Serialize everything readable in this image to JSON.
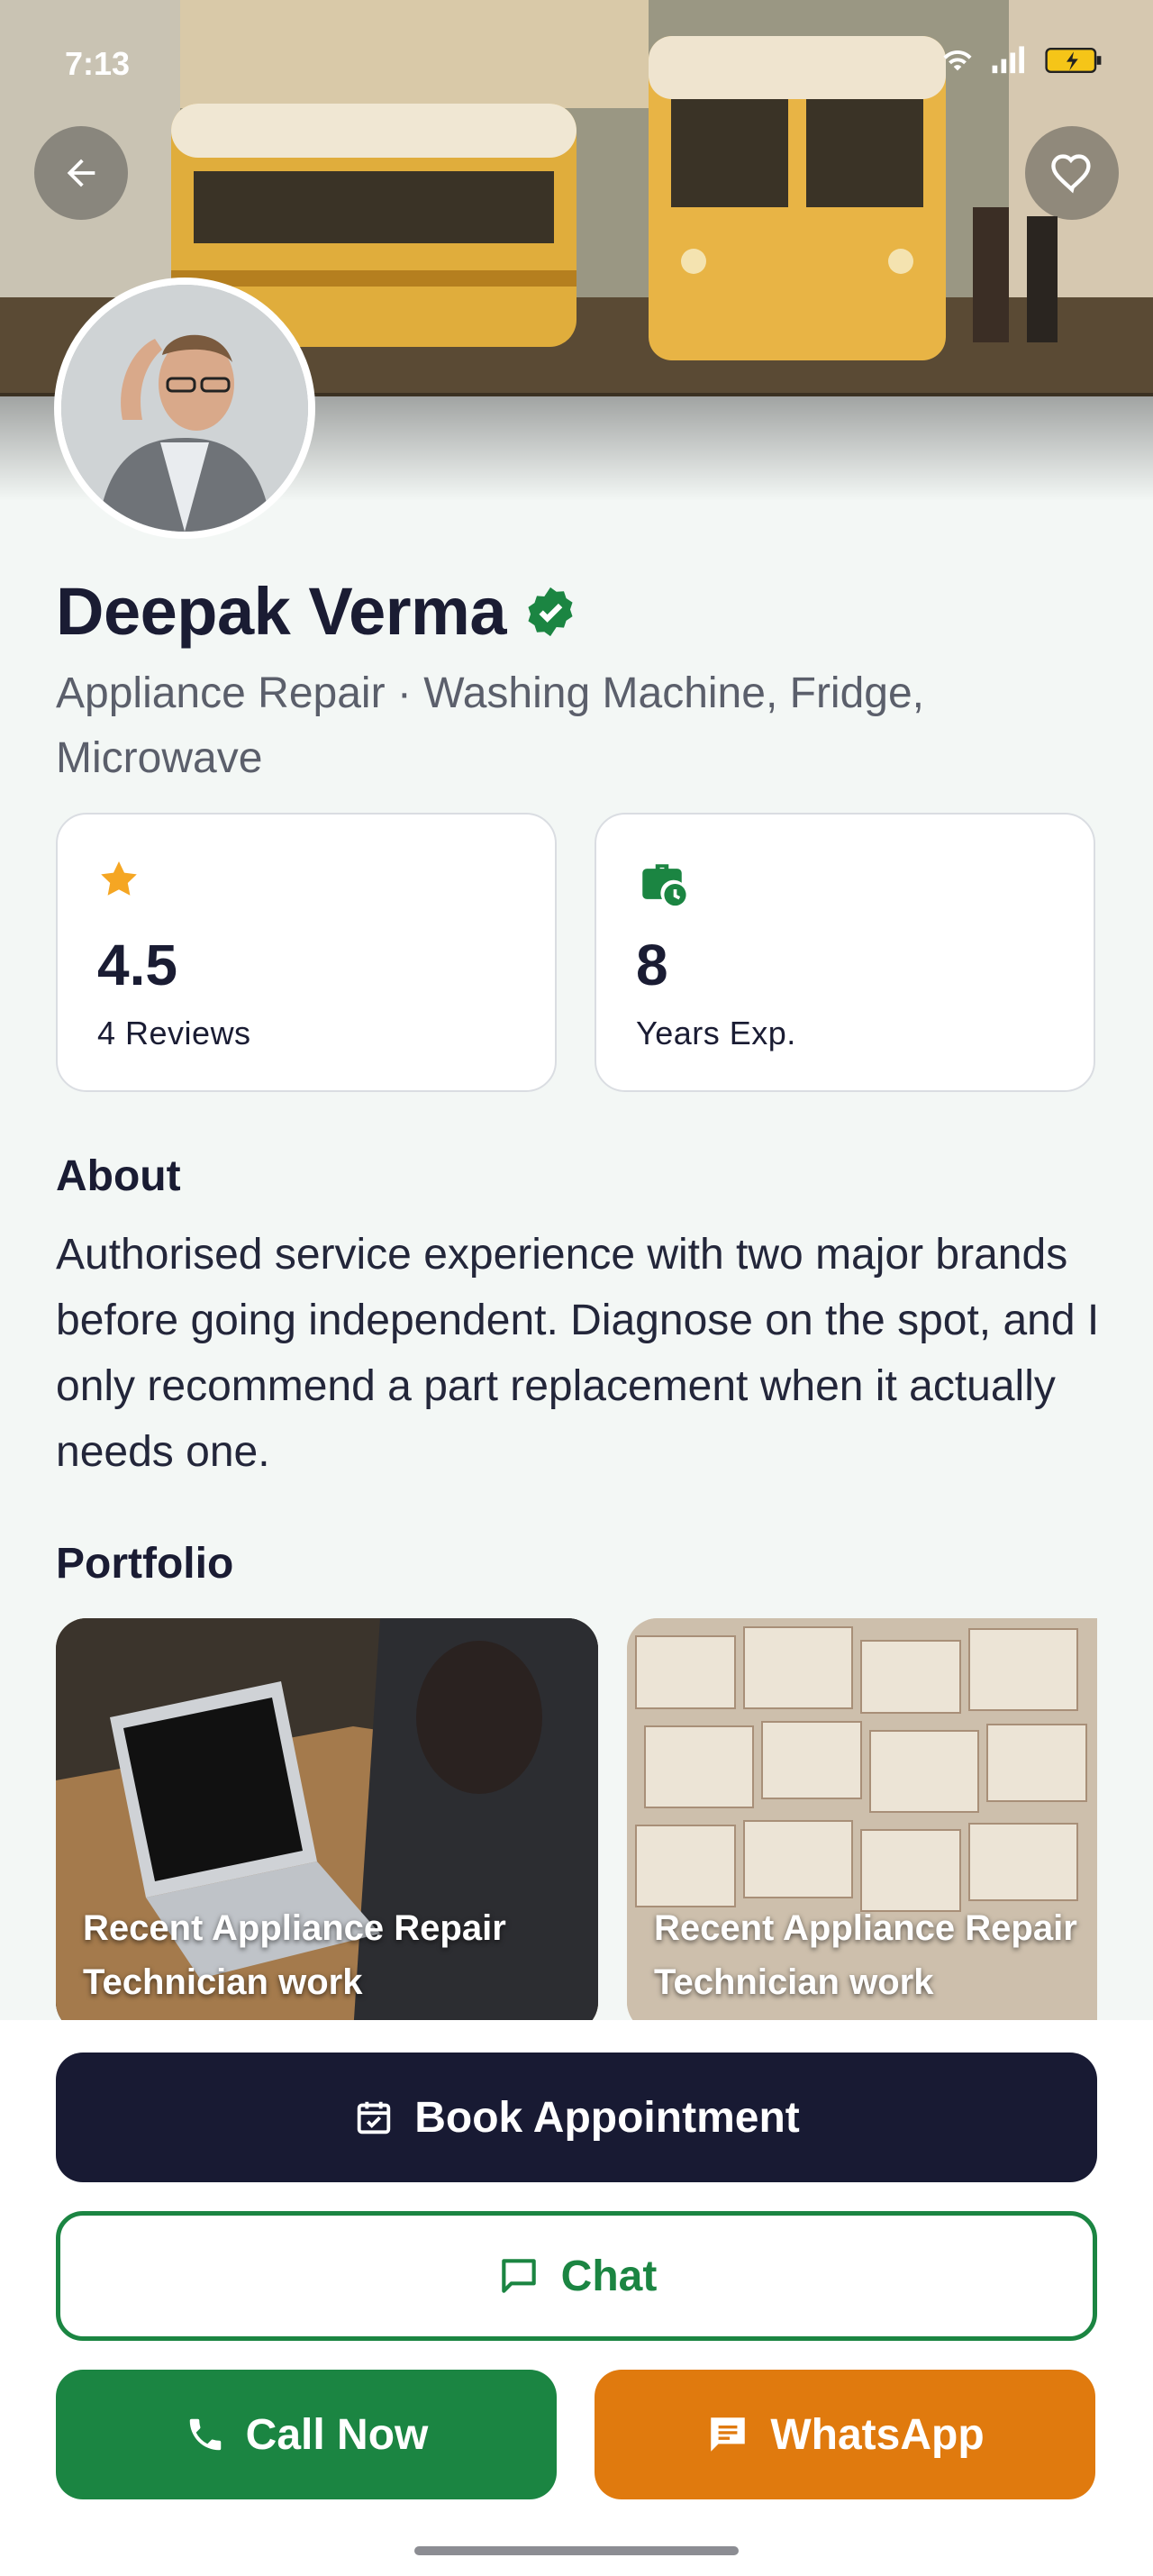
{
  "status_bar": {
    "time": "7:13"
  },
  "header": {
    "back_label": "back",
    "favorite_label": "favorite"
  },
  "profile": {
    "name": "Deepak Verma",
    "verified": true,
    "subtitle": "Appliance Repair · Washing Machine, Fridge, Microwave"
  },
  "stats": {
    "rating": {
      "value": "4.5",
      "label": "4 Reviews",
      "icon": "star-icon",
      "color": "#f5a623"
    },
    "experience": {
      "value": "8",
      "label": "Years Exp.",
      "icon": "briefcase-clock-icon",
      "color": "#1b8542"
    }
  },
  "about": {
    "title": "About",
    "body": "Authorised service experience with two major brands before going independent. Diagnose on the spot, and I only recommend a part replacement when it actually needs one."
  },
  "portfolio": {
    "title": "Portfolio",
    "items": [
      {
        "caption": "Recent Appliance Repair Technician work"
      },
      {
        "caption": "Recent Appliance Repair Technician work"
      }
    ]
  },
  "actions": {
    "book": "Book Appointment",
    "chat": "Chat",
    "call": "Call Now",
    "whatsapp": "WhatsApp"
  },
  "colors": {
    "primary_dark": "#181a33",
    "accent_green": "#1b8542",
    "accent_orange": "#e07a0e",
    "background": "#f3f7f5"
  }
}
